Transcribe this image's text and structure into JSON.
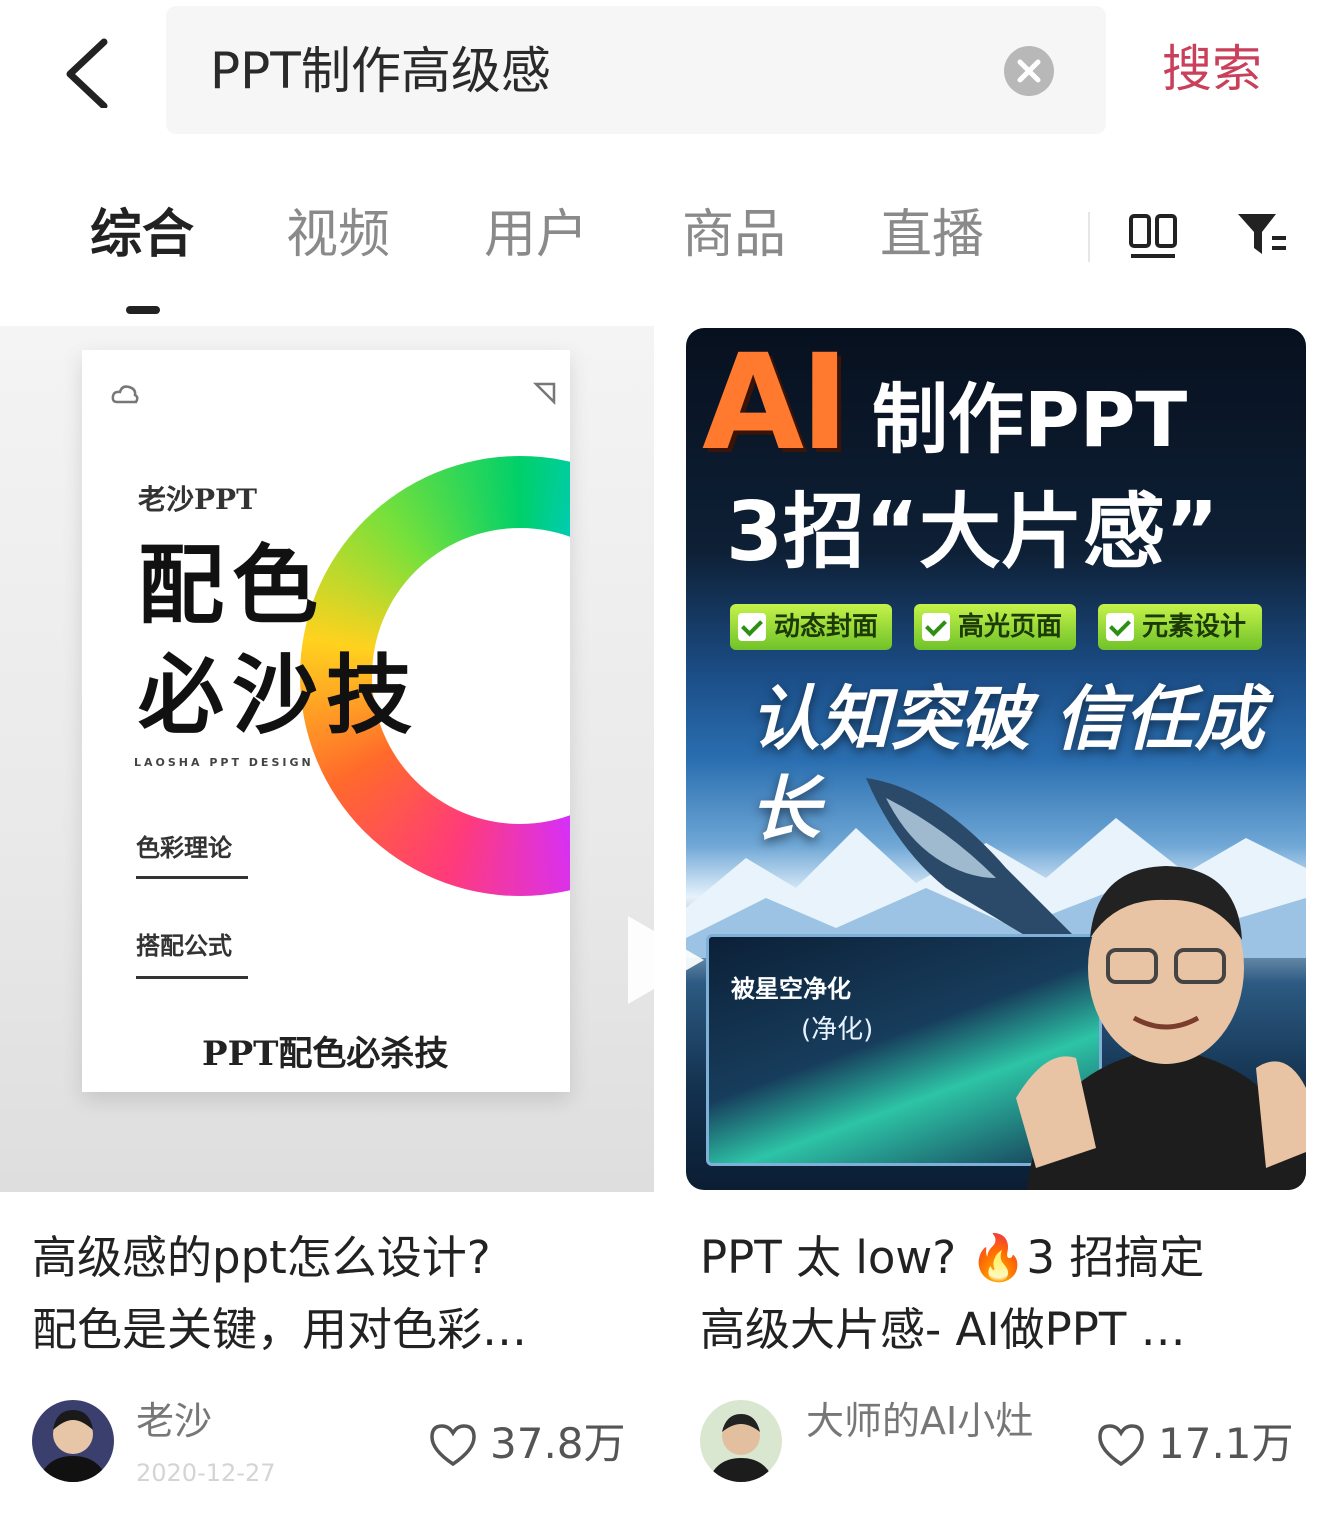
{
  "header": {
    "back_icon": "chevron-left-icon",
    "query": "PPT制作高级感",
    "clear_icon": "clear-circle-icon",
    "search_label": "搜索",
    "accent_color": "#c9405b"
  },
  "tabs": {
    "items": [
      {
        "label": "综合",
        "active": true
      },
      {
        "label": "视频",
        "active": false
      },
      {
        "label": "用户",
        "active": false
      },
      {
        "label": "商品",
        "active": false
      },
      {
        "label": "直播",
        "active": false
      }
    ],
    "layout_icon": "double-column-layout-icon",
    "filter_icon": "filter-icon"
  },
  "results": [
    {
      "thumbnail": {
        "brand": "老沙PPT",
        "headline_line1": "配色",
        "headline_line2": "必沙技",
        "english": "LAOSHA PPT DESIGN",
        "sub1": "色彩理论",
        "sub2": "搭配公式",
        "footer": "PPT配色必杀技"
      },
      "title_line1": "高级感的ppt怎么设计?",
      "title_line2": "配色是关键，用对色彩…",
      "author": "老沙",
      "date": "2020-12-27",
      "likes": "37.8万"
    },
    {
      "thumbnail": {
        "big_ai": "AI",
        "title1": "制作PPT",
        "title2": "3招“大片感”",
        "tags": [
          "动态封面",
          "高光页面",
          "元素设计"
        ],
        "slogan": "认知突破 信任成长",
        "inner_title": "被星空净化",
        "inner_sub": "(净化)"
      },
      "title_line1": "PPT 太 low? 🔥3 招搞定",
      "title_line2": "高级大片感- AI做PPT …",
      "author": "大师的AI小灶",
      "likes": "17.1万"
    }
  ]
}
